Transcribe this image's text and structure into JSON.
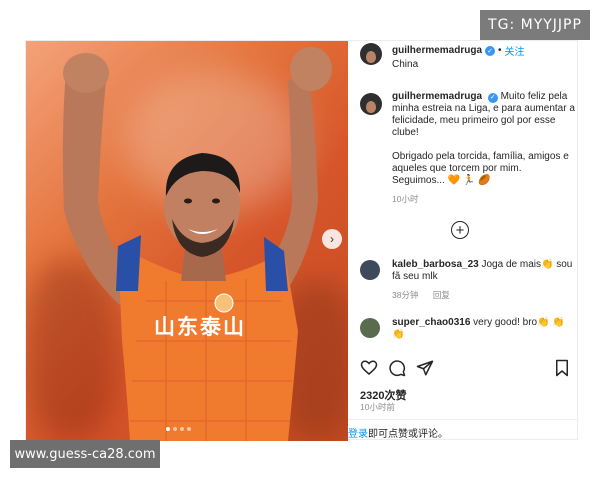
{
  "badges": {
    "telegram": "TG: MYYJJPP",
    "site_url": "www.guess-ca28.com"
  },
  "post": {
    "header": {
      "username": "guilhermemadruga",
      "follow_label": "关注",
      "location": "China"
    },
    "photo": {
      "jersey_text": "山东泰山",
      "slide_count": 4,
      "active_slide": 1
    },
    "caption": {
      "username": "guilhermemadruga",
      "paragraph1": "Muito feliz pela minha estreia na Liga, e para aumentar a felicidade, meu primeiro gol por esse clube!",
      "paragraph2": "Obrigado pela torcida, família, amigos e aqueles que torcem por mim. Seguimos... 🧡 🏃 🏉",
      "time": "10小时"
    },
    "comments": [
      {
        "username": "kaleb_barbosa_23",
        "text": "Joga de mais👏 sou fã seu mlk",
        "time": "38分钟",
        "reply_label": "回复",
        "avatar_color": "#3c4a5c"
      },
      {
        "username": "super_chao0316",
        "text": "very good!  bro👏 👏👏",
        "avatar_color": "#5a6b4e"
      }
    ],
    "actions": {
      "like_icon": "heart-icon",
      "comment_icon": "comment-icon",
      "share_icon": "send-icon",
      "save_icon": "bookmark-icon"
    },
    "likes": "2320次赞",
    "post_time": "10小时前",
    "login_prompt": {
      "link": "登录",
      "text": "即可点赞或评论。"
    }
  },
  "colors": {
    "accent_blue": "#0095f6",
    "jersey_orange": "#f07a2e"
  }
}
